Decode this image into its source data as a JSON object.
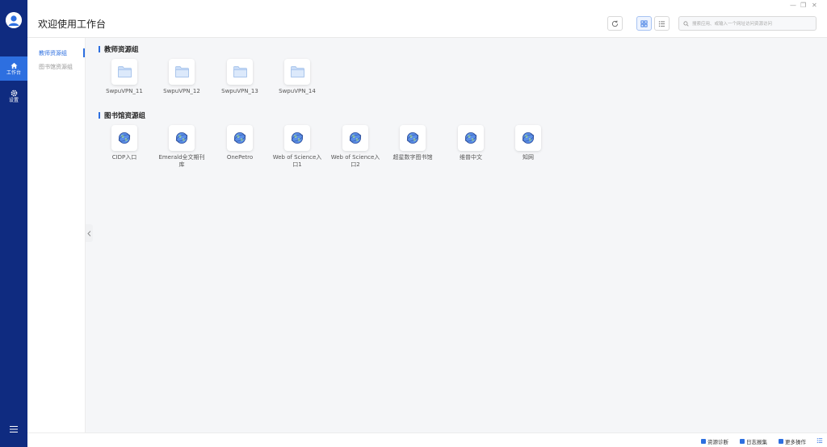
{
  "header": {
    "title": "欢迎使用工作台",
    "search_placeholder": "搜索应用、或输入一个网址访问资源访问"
  },
  "rail": {
    "items": [
      {
        "label": "工作台",
        "icon": "home-icon",
        "active": true
      },
      {
        "label": "设置",
        "icon": "gear-icon",
        "active": false
      }
    ]
  },
  "subnav": {
    "items": [
      {
        "label": "教师资源组",
        "active": true
      },
      {
        "label": "图书馆资源组",
        "active": false
      }
    ]
  },
  "sections": [
    {
      "title": "教师资源组",
      "tiles": [
        {
          "label": "SwpuVPN_11",
          "icon": "folder-icon"
        },
        {
          "label": "SwpuVPN_12",
          "icon": "folder-icon"
        },
        {
          "label": "SwpuVPN_13",
          "icon": "folder-icon"
        },
        {
          "label": "SwpuVPN_14",
          "icon": "folder-icon"
        }
      ]
    },
    {
      "title": "图书馆资源组",
      "tiles": [
        {
          "label": "CIDP入口",
          "icon": "globe-icon"
        },
        {
          "label": "Emerald全文期刊库",
          "icon": "globe-icon"
        },
        {
          "label": "OnePetro",
          "icon": "globe-icon"
        },
        {
          "label": "Web of Science入口1",
          "icon": "globe-icon"
        },
        {
          "label": "Web of Science入口2",
          "icon": "globe-icon"
        },
        {
          "label": "超星数字图书馆",
          "icon": "globe-icon"
        },
        {
          "label": "维普中文",
          "icon": "globe-icon"
        },
        {
          "label": "知网",
          "icon": "globe-icon"
        }
      ]
    }
  ],
  "footer": {
    "items": [
      {
        "label": "资源诊断",
        "icon": "diagnose-icon"
      },
      {
        "label": "日志报集",
        "icon": "log-icon"
      },
      {
        "label": "更多操作",
        "icon": "more-icon"
      }
    ]
  },
  "colors": {
    "rail": "#0f2b80",
    "accent": "#2d6fe0"
  }
}
